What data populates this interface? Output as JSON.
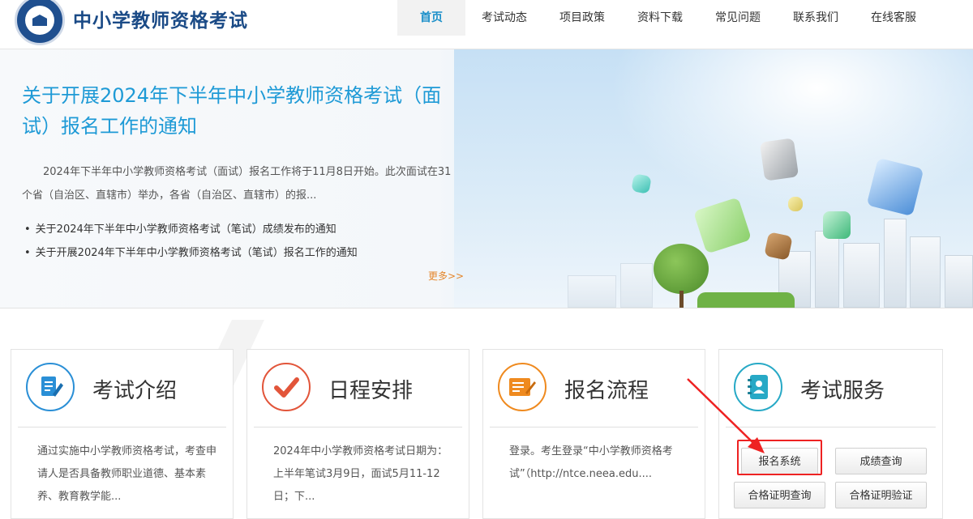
{
  "header": {
    "site_title": "中小学教师资格考试",
    "nav": [
      {
        "label": "首页",
        "active": true
      },
      {
        "label": "考试动态"
      },
      {
        "label": "项目政策"
      },
      {
        "label": "资料下载"
      },
      {
        "label": "常见问题"
      },
      {
        "label": "联系我们"
      },
      {
        "label": "在线客服"
      }
    ]
  },
  "banner": {
    "headline": "关于开展2024年下半年中小学教师资格考试（面试）报名工作的通知",
    "summary": "2024年下半年中小学教师资格考试（面试）报名工作将于11月8日开始。此次面试在31个省（自治区、直辖市）举办，各省（自治区、直辖市）的报...",
    "news": [
      "关于2024年下半年中小学教师资格考试（笔试）成绩发布的通知",
      "关于开展2024年下半年中小学教师资格考试（笔试）报名工作的通知"
    ],
    "more": "更多>>"
  },
  "cards": [
    {
      "title": "考试介绍",
      "icon": "document-pen-icon",
      "color": "#2a8fd6",
      "desc": "通过实施中小学教师资格考试，考查申请人是否具备教师职业道德、基本素养、教育教学能..."
    },
    {
      "title": "日程安排",
      "icon": "checkmark-icon",
      "color": "#e2553a",
      "desc": "2024年中小学教师资格考试日期为：上半年笔试3月9日，面试5月11-12日；下..."
    },
    {
      "title": "报名流程",
      "icon": "form-pen-icon",
      "color": "#ef8a1f",
      "desc": "登录。考生登录“中小学教师资格考试”（http://ntce.neea.edu...."
    },
    {
      "title": "考试服务",
      "icon": "contact-book-icon",
      "color": "#27a9c6",
      "buttons": [
        "报名系统",
        "成绩查询",
        "合格证明查询",
        "合格证明验证"
      ]
    }
  ],
  "colors": {
    "accent_blue": "#1e9ad6",
    "title_navy": "#1a4a86",
    "more_orange": "#e4862b",
    "annotation_red": "#ee2222"
  }
}
